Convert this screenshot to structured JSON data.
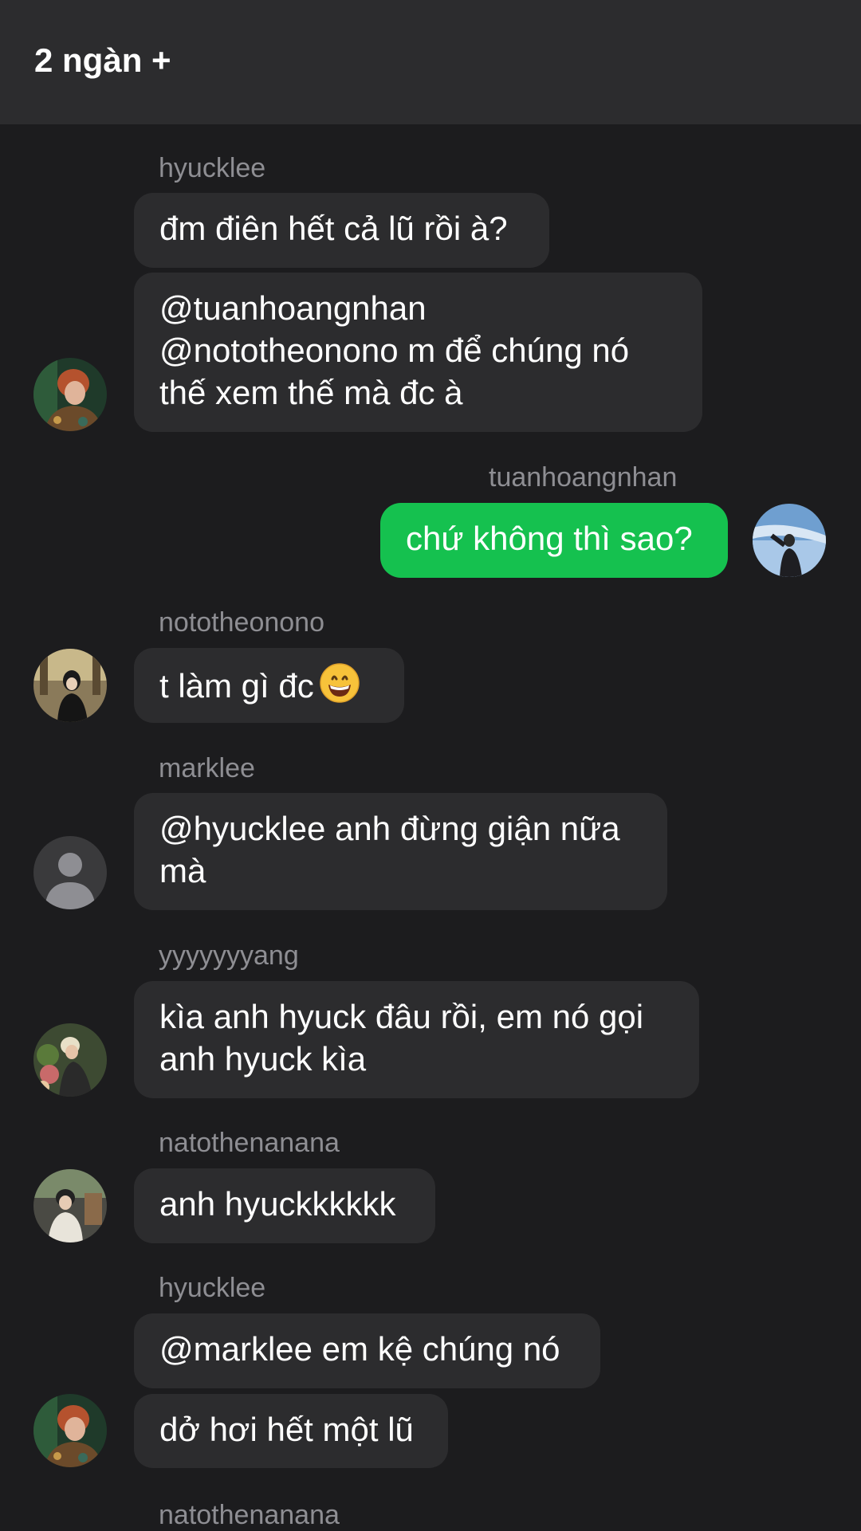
{
  "header": {
    "title": "2 ngàn +"
  },
  "messages": [
    {
      "sender": "hyucklee",
      "bubbles": [
        "đm điên hết cả lũ rồi à?"
      ],
      "multiline_bubble": [
        "@tuanhoangnhan",
        "@nototheonono m để chúng nó",
        "thế xem thế mà đc à"
      ],
      "avatar_icon": "profile-photo-icon"
    },
    {
      "sender": "tuanhoangnhan",
      "text": "chứ không thì sao?",
      "is_mine": true,
      "avatar_icon": "profile-photo-icon"
    },
    {
      "sender": "nototheonono",
      "text": "t làm gì đc",
      "emoji": "grinning-face-icon",
      "avatar_icon": "profile-photo-icon"
    },
    {
      "sender": "marklee",
      "lines": [
        "@hyucklee anh đừng giận nữa",
        "mà"
      ],
      "avatar_icon": "default-user-icon"
    },
    {
      "sender": "yyyyyyyang",
      "lines": [
        "kìa anh hyuck đâu rồi, em nó gọi",
        "anh hyuck kìa"
      ],
      "avatar_icon": "profile-photo-icon"
    },
    {
      "sender": "natothenanana",
      "text": "anh hyuckkkkkk",
      "avatar_icon": "profile-photo-icon"
    },
    {
      "sender": "hyucklee",
      "bubbles": [
        "@marklee em kệ chúng nó",
        "dở hơi hết một lũ"
      ],
      "avatar_icon": "profile-photo-icon"
    },
    {
      "sender": "natothenanana"
    }
  ],
  "colors": {
    "background": "#1c1c1e",
    "header": "#2c2c2e",
    "bubble_other": "#2c2c2e",
    "bubble_mine": "#15c14f",
    "username": "#8e8e93"
  }
}
